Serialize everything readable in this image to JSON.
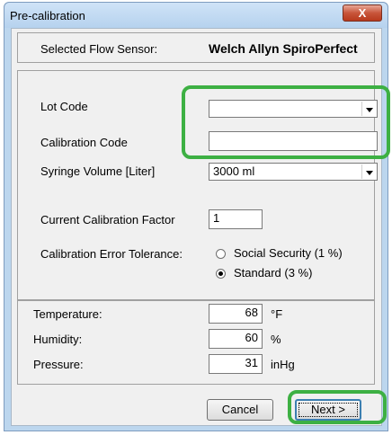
{
  "window": {
    "title": "Pre-calibration",
    "close_label": "X"
  },
  "sensor": {
    "label": "Selected Flow Sensor:",
    "value": "Welch Allyn SpiroPerfect"
  },
  "lot_code": {
    "label": "Lot Code",
    "value": ""
  },
  "calibration_code": {
    "label": "Calibration Code",
    "value": ""
  },
  "syringe_volume": {
    "label": "Syringe Volume [Liter]",
    "value": "3000 ml"
  },
  "calibration_factor": {
    "label": "Current Calibration Factor",
    "value": "1"
  },
  "error_tolerance": {
    "label": "Calibration Error Tolerance:",
    "options": [
      {
        "label": "Social Security (1 %)",
        "selected": false
      },
      {
        "label": "Standard (3 %)",
        "selected": true
      }
    ]
  },
  "temperature": {
    "label": "Temperature:",
    "value": "68",
    "unit": "°F"
  },
  "humidity": {
    "label": "Humidity:",
    "value": "60",
    "unit": "%"
  },
  "pressure": {
    "label": "Pressure:",
    "value": "31",
    "unit": "inHg"
  },
  "buttons": {
    "cancel": "Cancel",
    "next": "Next >"
  },
  "colors": {
    "highlight": "#3db043",
    "titlebar": "#bcd6ee",
    "close": "#c8553a"
  },
  "icons": {
    "close": "close-icon",
    "dropdown": "chevron-down-icon"
  }
}
